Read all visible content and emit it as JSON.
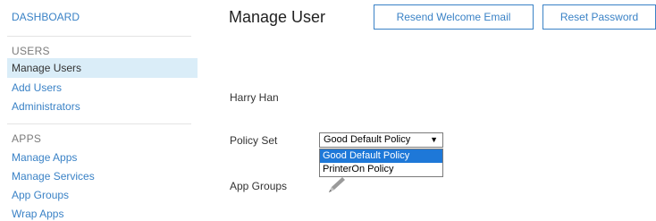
{
  "sidebar": {
    "dashboard": "DASHBOARD",
    "users_heading": "USERS",
    "users_items": [
      "Manage Users",
      "Add Users",
      "Administrators"
    ],
    "apps_heading": "APPS",
    "apps_items": [
      "Manage Apps",
      "Manage Services",
      "App Groups",
      "Wrap Apps"
    ]
  },
  "main": {
    "title": "Manage User",
    "resend_button": "Resend Welcome Email",
    "reset_button": "Reset Password",
    "user_name": "Harry Han",
    "policy_label": "Policy Set",
    "policy_selected": "Good Default Policy",
    "policy_arrow": "▼",
    "policy_options": [
      "Good Default Policy",
      "PrinterOn Policy"
    ],
    "app_groups_label": "App Groups",
    "edit_icon": "pencil-icon"
  },
  "colors": {
    "link": "#3a82c6",
    "active_row": "#daedf8",
    "selected_option": "#1e78d8"
  }
}
